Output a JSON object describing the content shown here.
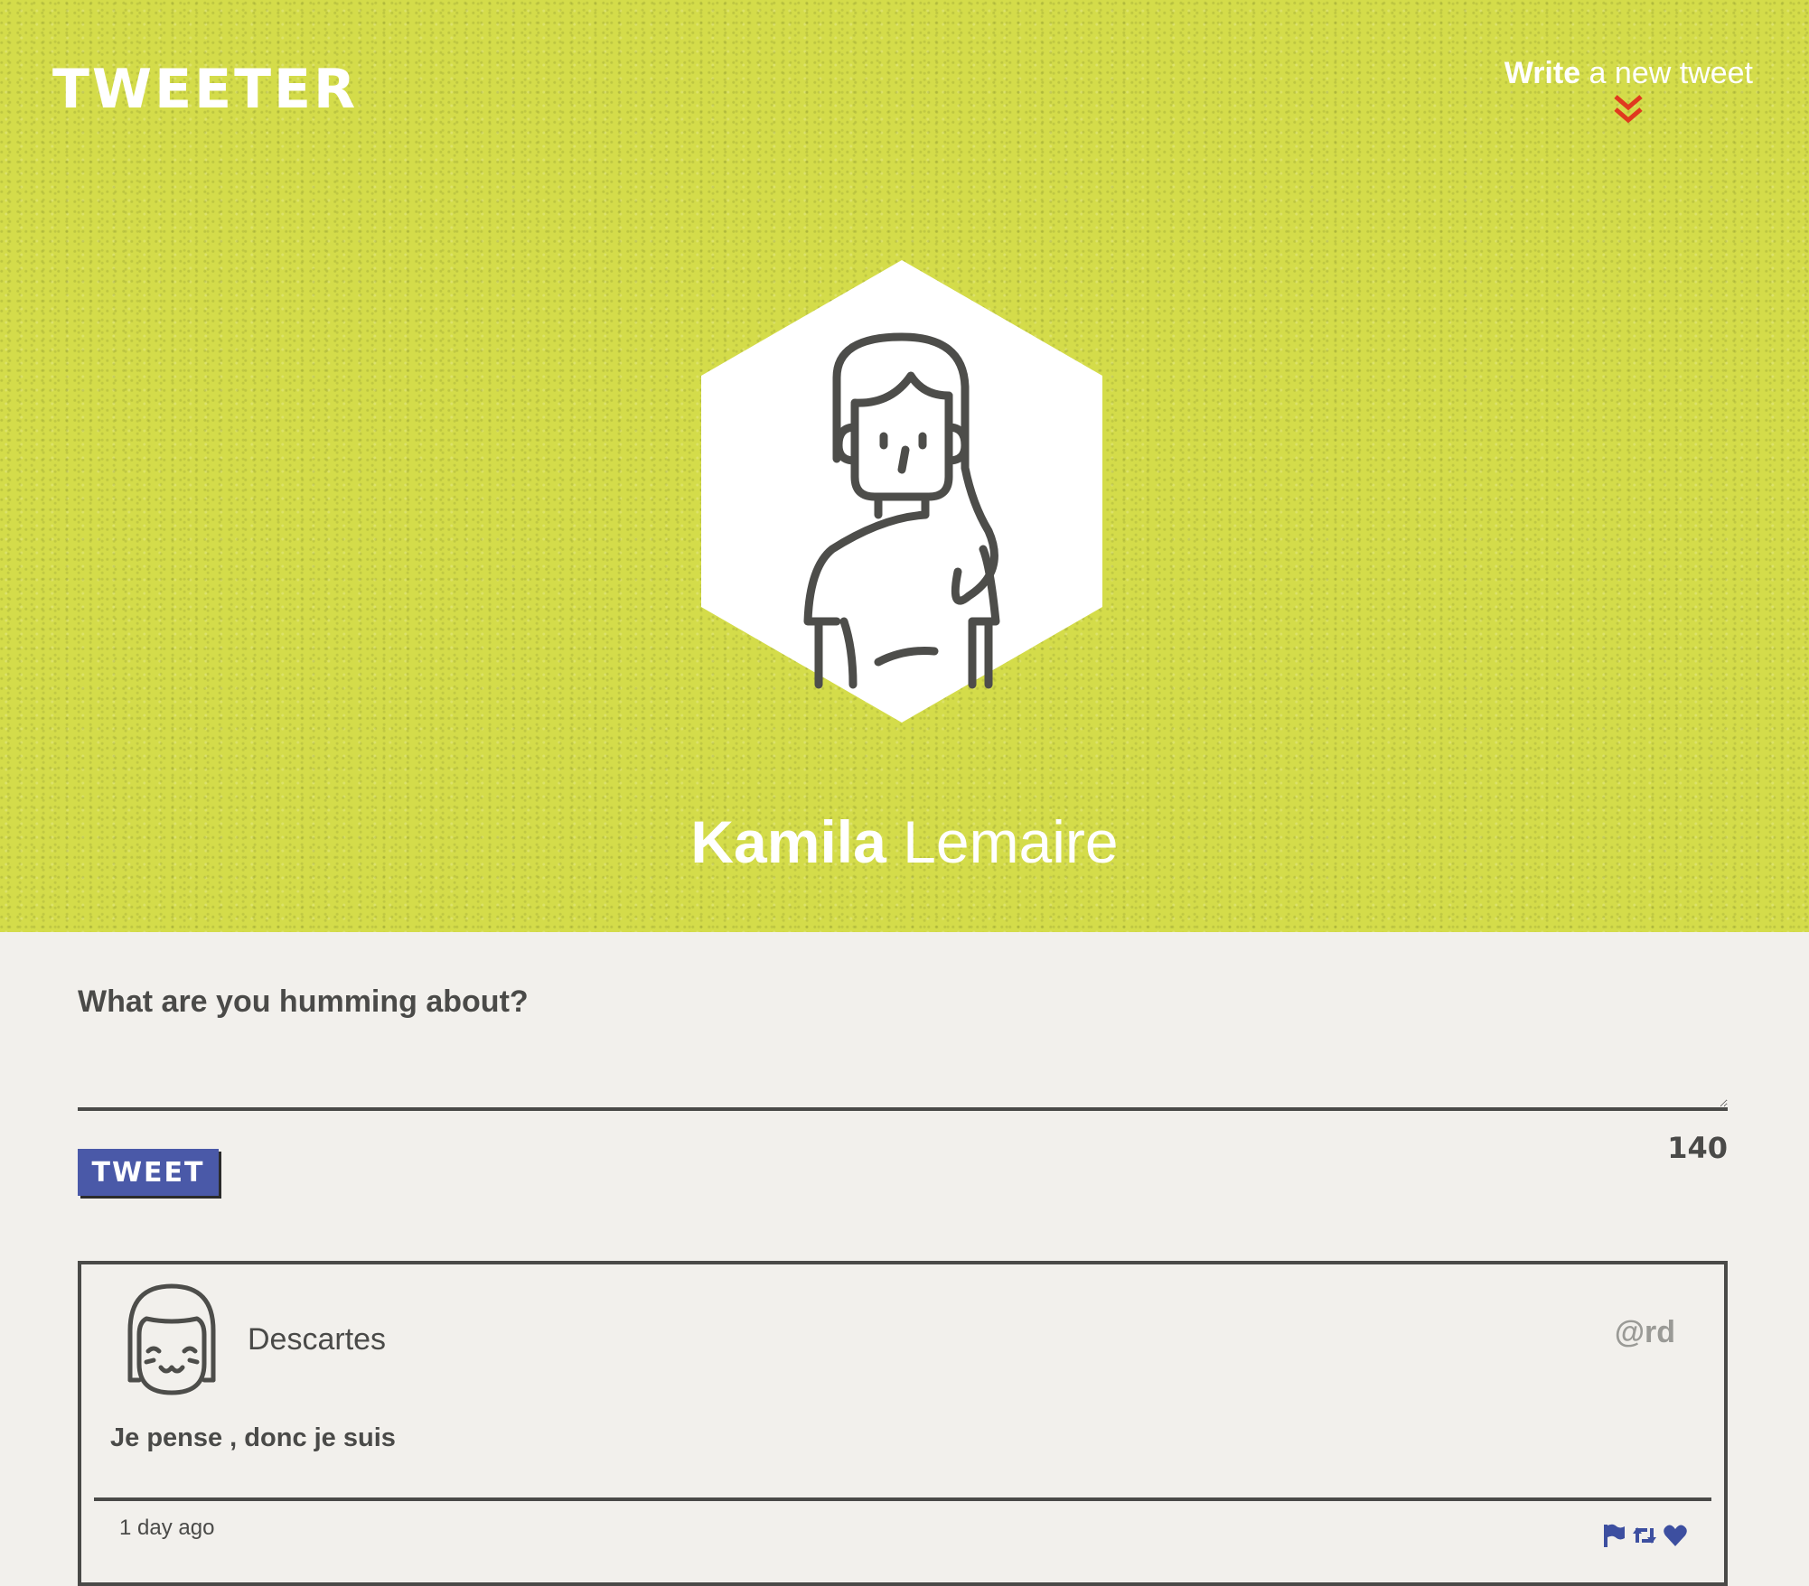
{
  "header": {
    "logo": "TWEETER",
    "compose_toggle": {
      "strong": "Write",
      "light": " a new tweet",
      "icon": "double-chevron-down-icon",
      "icon_color": "#e0391f"
    }
  },
  "profile": {
    "first_name": "Kamila",
    "last_name": " Lemaire",
    "avatar_icon": "person-long-hair-avatar",
    "hero_color": "#d4dc4a"
  },
  "composer": {
    "label": "What are you humming about?",
    "textarea_value": "",
    "tweet_button": "TWEET",
    "counter": "140",
    "button_color": "#4a59a8"
  },
  "tweets": [
    {
      "author": "Descartes",
      "handle": "@rd",
      "avatar_icon": "smiling-bob-hair-avatar",
      "text": "Je pense , donc je suis",
      "time": "1 day ago",
      "actions": [
        "flag-icon",
        "retweet-icon",
        "heart-icon"
      ],
      "action_color": "#3d4fa0"
    }
  ]
}
